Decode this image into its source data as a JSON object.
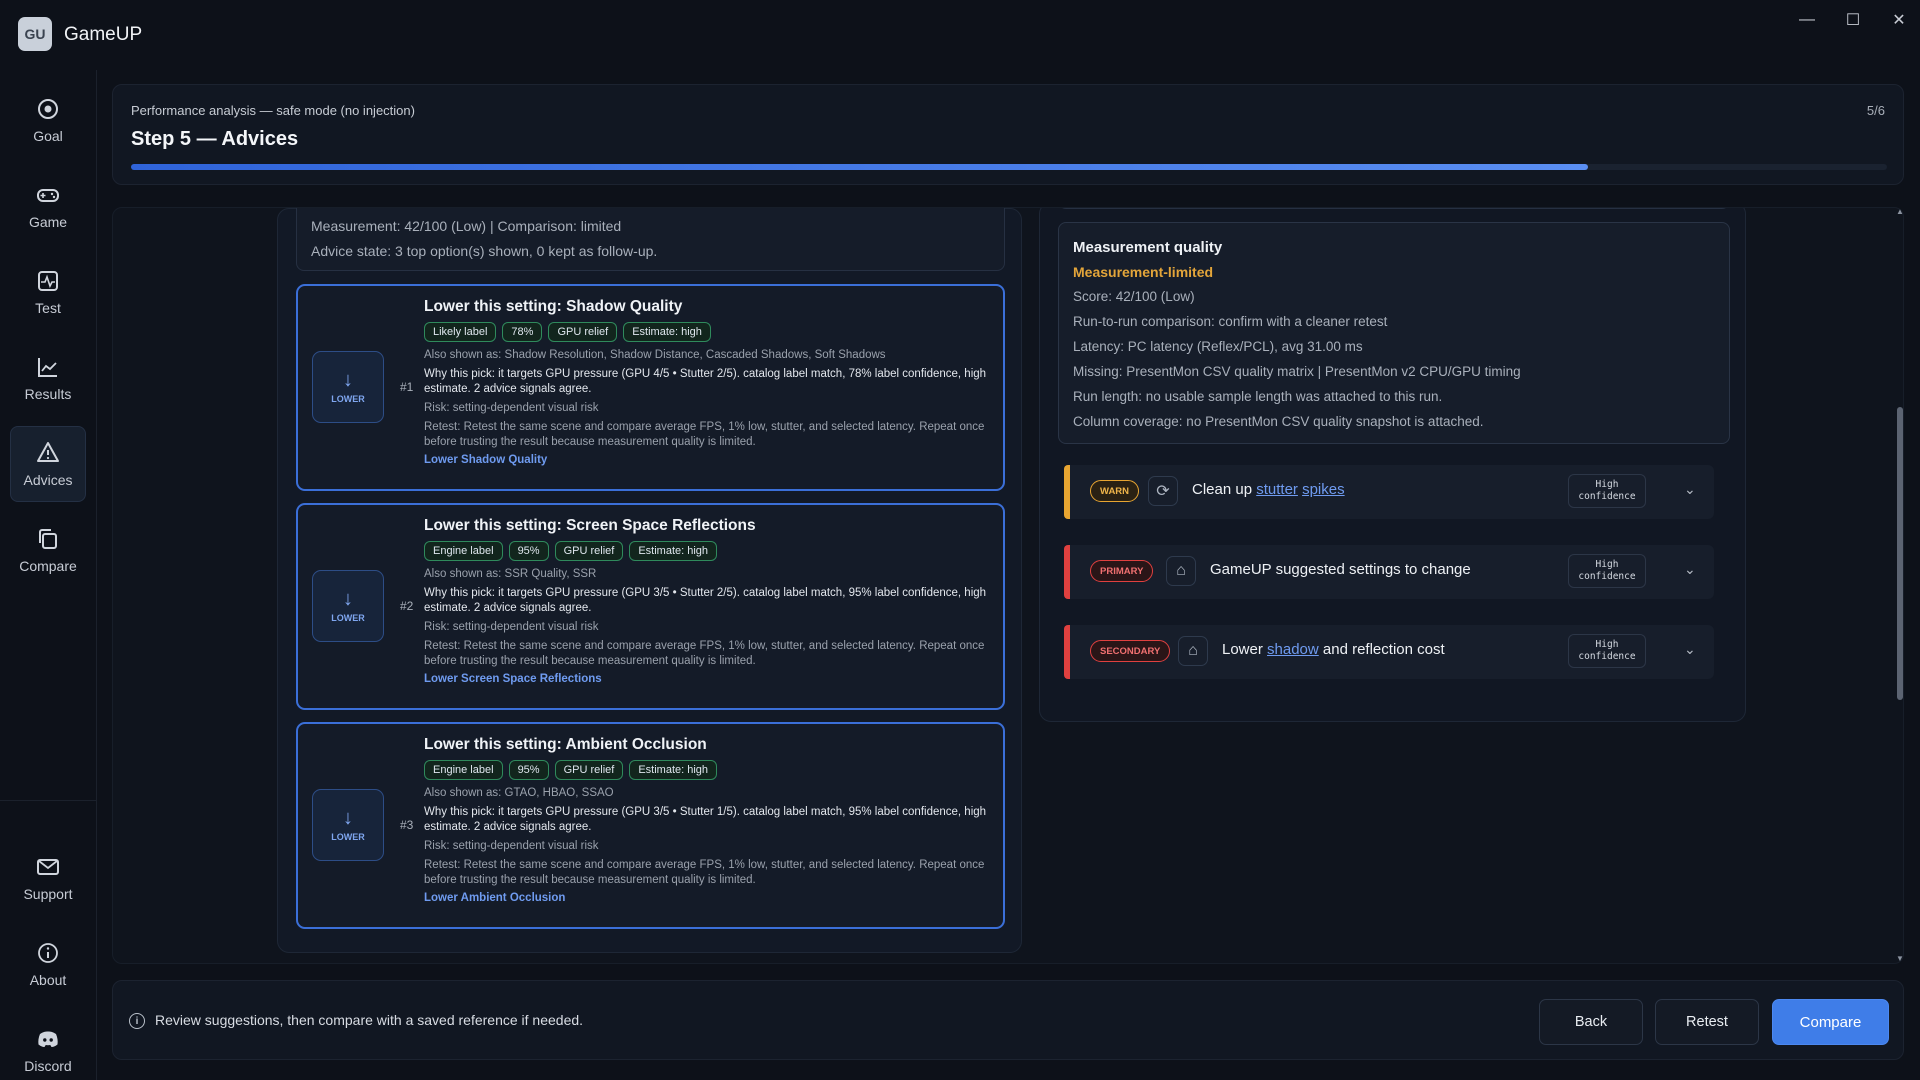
{
  "app": {
    "logo": "GU",
    "title": "GameUP"
  },
  "window_controls": {
    "minimize": "—",
    "maximize": "☐",
    "close": "✕"
  },
  "sidebar": {
    "items": [
      {
        "label": "Goal",
        "icon": "target-icon"
      },
      {
        "label": "Game",
        "icon": "gamepad-icon"
      },
      {
        "label": "Test",
        "icon": "pulse-icon"
      },
      {
        "label": "Results",
        "icon": "chart-icon"
      },
      {
        "label": "Advices",
        "icon": "warning-icon",
        "active": true
      },
      {
        "label": "Compare",
        "icon": "copy-icon"
      }
    ],
    "bottom": [
      {
        "label": "Support",
        "icon": "mail-icon"
      },
      {
        "label": "About",
        "icon": "info-icon"
      },
      {
        "label": "Discord",
        "icon": "discord-icon"
      }
    ]
  },
  "header": {
    "breadcrumb": "Performance analysis — safe mode (no injection)",
    "title": "Step 5 — Advices",
    "step_counter": "5/6",
    "progress": 0.83
  },
  "summary": {
    "measurement": "Measurement: 42/100 (Low) | Comparison: limited",
    "advice_state": "Advice state: 3 top option(s) shown, 0 kept as follow-up."
  },
  "advices": [
    {
      "rank": "#1",
      "badge": "LOWER",
      "title": "Lower this setting: Shadow Quality",
      "chips": [
        "Likely label",
        "78%",
        "GPU relief",
        "Estimate: high"
      ],
      "also": "Also shown as: Shadow Resolution, Shadow Distance, Cascaded Shadows, Soft Shadows",
      "why": "Why this pick: it targets GPU pressure (GPU 4/5 • Stutter 2/5). catalog label match, 78% label confidence, high estimate. 2 advice signals agree.",
      "risk": "Risk: setting-dependent visual risk",
      "retest": "Retest: Retest the same scene and compare average FPS, 1% low, stutter, and selected latency. Repeat once before trusting the result because measurement quality is limited.",
      "link": "Lower Shadow Quality"
    },
    {
      "rank": "#2",
      "badge": "LOWER",
      "title": "Lower this setting: Screen Space Reflections",
      "chips": [
        "Engine label",
        "95%",
        "GPU relief",
        "Estimate: high"
      ],
      "also": "Also shown as: SSR Quality, SSR",
      "why": "Why this pick: it targets GPU pressure (GPU 3/5 • Stutter 2/5). catalog label match, 95% label confidence, high estimate. 2 advice signals agree.",
      "risk": "Risk: setting-dependent visual risk",
      "retest": "Retest: Retest the same scene and compare average FPS, 1% low, stutter, and selected latency. Repeat once before trusting the result because measurement quality is limited.",
      "link": "Lower Screen Space Reflections"
    },
    {
      "rank": "#3",
      "badge": "LOWER",
      "title": "Lower this setting: Ambient Occlusion",
      "chips": [
        "Engine label",
        "95%",
        "GPU relief",
        "Estimate: high"
      ],
      "also": "Also shown as: GTAO, HBAO, SSAO",
      "why": "Why this pick: it targets GPU pressure (GPU 3/5 • Stutter 1/5). catalog label match, 95% label confidence, high estimate. 2 advice signals agree.",
      "risk": "Risk: setting-dependent visual risk",
      "retest": "Retest: Retest the same scene and compare average FPS, 1% low, stutter, and selected latency. Repeat once before trusting the result because measurement quality is limited.",
      "link": "Lower Ambient Occlusion"
    }
  ],
  "quality": {
    "title": "Measurement quality",
    "status": "Measurement-limited",
    "lines": [
      "Score: 42/100 (Low)",
      "Run-to-run comparison: confirm with a cleaner retest",
      "Latency: PC latency (Reflex/PCL), avg 31.00 ms",
      "Missing: PresentMon CSV quality matrix | PresentMon v2 CPU/GPU timing",
      "Run length: no usable sample length was attached to this run.",
      "Column coverage: no PresentMon CSV quality snapshot is attached."
    ]
  },
  "recommendations": [
    {
      "tag": "WARN",
      "color": "#e8a531",
      "icon": "refresh-icon",
      "pre": "Clean up ",
      "u1": "stutter",
      "mid": " ",
      "u2": "spikes",
      "post": "",
      "conf1": "High",
      "conf2": "confidence"
    },
    {
      "tag": "PRIMARY",
      "color": "#e0403f",
      "icon": "monitor-icon",
      "pre": "GameUP suggested settings to change",
      "u1": "",
      "mid": "",
      "u2": "",
      "post": "",
      "conf1": "High",
      "conf2": "confidence"
    },
    {
      "tag": "SECONDARY",
      "color": "#e0403f",
      "icon": "monitor-icon",
      "pre": "Lower ",
      "u1": "shadow",
      "mid": " and reflection cost",
      "u2": "",
      "post": "",
      "conf1": "High",
      "conf2": "confidence"
    }
  ],
  "footer": {
    "info": "Review suggestions, then compare with a saved reference if needed.",
    "back": "Back",
    "retest": "Retest",
    "compare": "Compare"
  }
}
